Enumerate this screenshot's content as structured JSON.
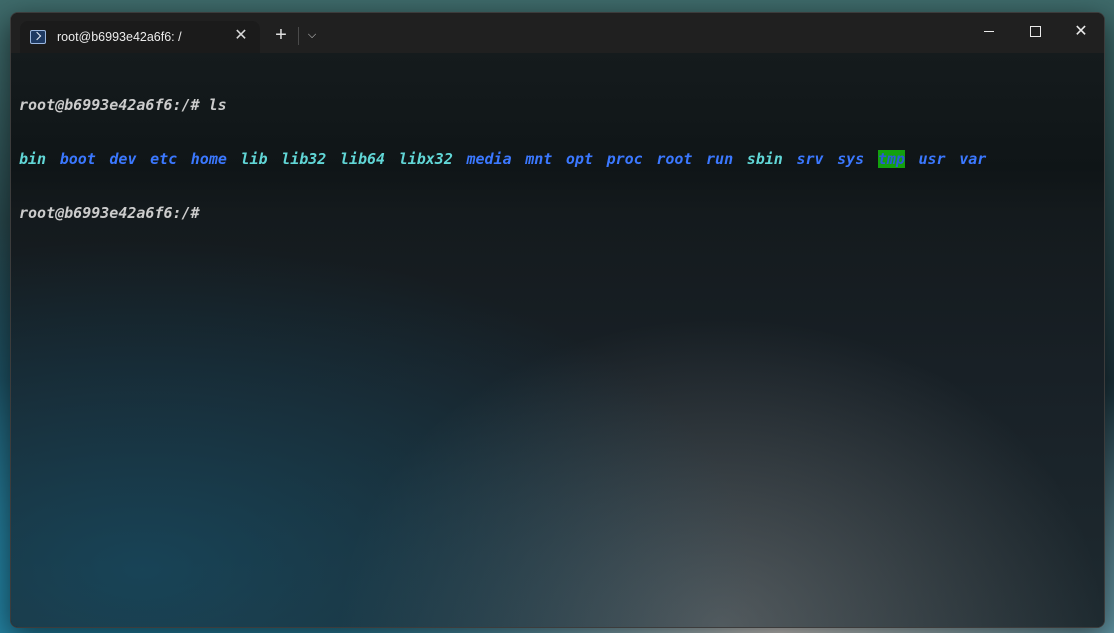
{
  "window": {
    "tab_title": "root@b6993e42a6f6: /",
    "close_tab_symbol": "✕",
    "new_tab_symbol": "+",
    "dropdown_symbol": "⌵",
    "controls": {
      "close_symbol": "✕"
    }
  },
  "terminal": {
    "prompt": "root@b6993e42a6f6:/# ",
    "command": "ls",
    "entries": [
      {
        "name": "bin",
        "color": "#61d6d6"
      },
      {
        "name": "boot",
        "color": "#3b78ff"
      },
      {
        "name": "dev",
        "color": "#3b78ff"
      },
      {
        "name": "etc",
        "color": "#3b78ff"
      },
      {
        "name": "home",
        "color": "#3b78ff"
      },
      {
        "name": "lib",
        "color": "#61d6d6"
      },
      {
        "name": "lib32",
        "color": "#61d6d6"
      },
      {
        "name": "lib64",
        "color": "#61d6d6"
      },
      {
        "name": "libx32",
        "color": "#61d6d6"
      },
      {
        "name": "media",
        "color": "#3b78ff"
      },
      {
        "name": "mnt",
        "color": "#3b78ff"
      },
      {
        "name": "opt",
        "color": "#3b78ff"
      },
      {
        "name": "proc",
        "color": "#3b78ff"
      },
      {
        "name": "root",
        "color": "#3b78ff"
      },
      {
        "name": "run",
        "color": "#3b78ff"
      },
      {
        "name": "sbin",
        "color": "#61d6d6"
      },
      {
        "name": "srv",
        "color": "#3b78ff"
      },
      {
        "name": "sys",
        "color": "#3b78ff"
      },
      {
        "name": "tmp",
        "color": "#2b5bd6",
        "highlight": "#13a10e"
      },
      {
        "name": "usr",
        "color": "#3b78ff"
      },
      {
        "name": "var",
        "color": "#3b78ff"
      }
    ],
    "prompt2": "root@b6993e42a6f6:/#"
  }
}
